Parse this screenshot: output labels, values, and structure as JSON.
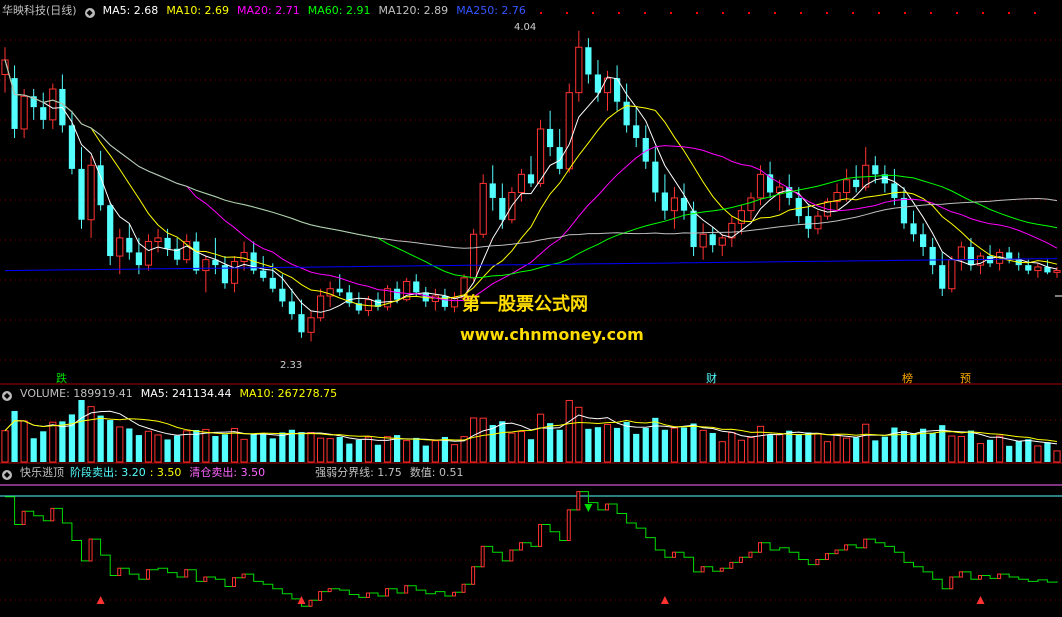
{
  "main": {
    "title": "华映科技(日线)",
    "ma5": "MA5: 2.68",
    "ma10": "MA10: 2.69",
    "ma20": "MA20: 2.71",
    "ma60": "MA60: 2.91",
    "ma120": "MA120: 2.89",
    "ma250": "MA250: 2.76",
    "high_label": "4.04",
    "low_label": "2.33",
    "markers": [
      "跌",
      "财",
      "榜",
      "预"
    ]
  },
  "volume": {
    "title": "VOLUME: 189919.41",
    "ma5": "MA5: 241134.44",
    "ma10": "MA10: 267278.75"
  },
  "indicator": {
    "title": "快乐逃顶",
    "stage_sell": "阶段卖出: 3.20",
    "stage_sell2": ": 3.50",
    "clear_sell": "清仓卖出: 3.50",
    "strength_line": "强弱分界线: 1.75",
    "value": "数值: 0.51"
  },
  "watermark": {
    "name": "第一股票公式网",
    "url": "www.chnmoney.com"
  },
  "colors": {
    "up": "#ff3232",
    "down": "#54ffff",
    "ma5": "#ffffff",
    "ma10": "#ffff00",
    "ma20": "#ff00ff",
    "ma60": "#00ff00",
    "ma120": "#c0c0c0",
    "ma250": "#0000ff",
    "separator": "#aa0000"
  },
  "chart_data": {
    "type": "candlestick",
    "price_range": [
      2.2,
      4.1
    ],
    "candles_ohlc": [
      [
        3.8,
        3.95,
        3.7,
        3.88
      ],
      [
        3.78,
        3.85,
        3.45,
        3.5
      ],
      [
        3.5,
        3.72,
        3.45,
        3.68
      ],
      [
        3.68,
        3.72,
        3.55,
        3.62
      ],
      [
        3.62,
        3.7,
        3.5,
        3.55
      ],
      [
        3.55,
        3.75,
        3.5,
        3.72
      ],
      [
        3.72,
        3.8,
        3.48,
        3.52
      ],
      [
        3.52,
        3.6,
        3.25,
        3.28
      ],
      [
        3.28,
        3.4,
        2.95,
        3.0
      ],
      [
        3.0,
        3.35,
        2.9,
        3.3
      ],
      [
        3.3,
        3.38,
        3.05,
        3.08
      ],
      [
        3.08,
        3.1,
        2.75,
        2.8
      ],
      [
        2.8,
        2.95,
        2.7,
        2.9
      ],
      [
        2.9,
        2.98,
        2.78,
        2.82
      ],
      [
        2.82,
        2.9,
        2.7,
        2.75
      ],
      [
        2.75,
        2.92,
        2.72,
        2.88
      ],
      [
        2.88,
        2.95,
        2.82,
        2.9
      ],
      [
        2.9,
        2.95,
        2.8,
        2.84
      ],
      [
        2.84,
        2.9,
        2.75,
        2.78
      ],
      [
        2.78,
        2.92,
        2.76,
        2.88
      ],
      [
        2.88,
        2.93,
        2.7,
        2.72
      ],
      [
        2.72,
        2.8,
        2.6,
        2.78
      ],
      [
        2.78,
        2.9,
        2.7,
        2.75
      ],
      [
        2.75,
        2.8,
        2.62,
        2.65
      ],
      [
        2.65,
        2.8,
        2.6,
        2.77
      ],
      [
        2.77,
        2.88,
        2.72,
        2.82
      ],
      [
        2.82,
        2.88,
        2.7,
        2.72
      ],
      [
        2.72,
        2.8,
        2.66,
        2.68
      ],
      [
        2.68,
        2.76,
        2.6,
        2.62
      ],
      [
        2.62,
        2.7,
        2.52,
        2.55
      ],
      [
        2.55,
        2.62,
        2.45,
        2.48
      ],
      [
        2.48,
        2.56,
        2.35,
        2.38
      ],
      [
        2.38,
        2.5,
        2.33,
        2.46
      ],
      [
        2.46,
        2.62,
        2.44,
        2.58
      ],
      [
        2.58,
        2.66,
        2.52,
        2.62
      ],
      [
        2.62,
        2.7,
        2.58,
        2.6
      ],
      [
        2.6,
        2.64,
        2.52,
        2.54
      ],
      [
        2.54,
        2.6,
        2.48,
        2.5
      ],
      [
        2.5,
        2.58,
        2.47,
        2.56
      ],
      [
        2.56,
        2.6,
        2.5,
        2.52
      ],
      [
        2.52,
        2.64,
        2.5,
        2.62
      ],
      [
        2.62,
        2.66,
        2.54,
        2.56
      ],
      [
        2.56,
        2.68,
        2.55,
        2.66
      ],
      [
        2.66,
        2.7,
        2.58,
        2.6
      ],
      [
        2.6,
        2.63,
        2.52,
        2.55
      ],
      [
        2.55,
        2.62,
        2.5,
        2.58
      ],
      [
        2.58,
        2.62,
        2.5,
        2.52
      ],
      [
        2.52,
        2.6,
        2.49,
        2.57
      ],
      [
        2.57,
        2.7,
        2.55,
        2.68
      ],
      [
        2.68,
        2.95,
        2.66,
        2.92
      ],
      [
        2.92,
        3.25,
        2.9,
        3.2
      ],
      [
        3.2,
        3.3,
        3.05,
        3.12
      ],
      [
        3.12,
        3.2,
        2.95,
        3.0
      ],
      [
        3.0,
        3.18,
        2.98,
        3.15
      ],
      [
        3.15,
        3.28,
        3.1,
        3.25
      ],
      [
        3.25,
        3.35,
        3.18,
        3.2
      ],
      [
        3.2,
        3.55,
        3.18,
        3.5
      ],
      [
        3.5,
        3.6,
        3.35,
        3.4
      ],
      [
        3.4,
        3.5,
        3.25,
        3.28
      ],
      [
        3.28,
        3.75,
        3.26,
        3.7
      ],
      [
        3.7,
        4.04,
        3.65,
        3.95
      ],
      [
        3.95,
        4.0,
        3.75,
        3.8
      ],
      [
        3.8,
        3.88,
        3.65,
        3.7
      ],
      [
        3.7,
        3.82,
        3.6,
        3.78
      ],
      [
        3.78,
        3.85,
        3.6,
        3.65
      ],
      [
        3.65,
        3.75,
        3.48,
        3.52
      ],
      [
        3.52,
        3.62,
        3.4,
        3.45
      ],
      [
        3.45,
        3.52,
        3.28,
        3.32
      ],
      [
        3.32,
        3.4,
        3.1,
        3.15
      ],
      [
        3.15,
        3.25,
        3.0,
        3.05
      ],
      [
        3.05,
        3.18,
        2.95,
        3.12
      ],
      [
        3.12,
        3.2,
        3.0,
        3.05
      ],
      [
        3.05,
        3.1,
        2.8,
        2.85
      ],
      [
        2.85,
        2.98,
        2.78,
        2.92
      ],
      [
        2.92,
        2.96,
        2.82,
        2.86
      ],
      [
        2.86,
        2.92,
        2.8,
        2.9
      ],
      [
        2.9,
        3.02,
        2.85,
        2.98
      ],
      [
        2.98,
        3.08,
        2.92,
        3.05
      ],
      [
        3.05,
        3.15,
        3.0,
        3.12
      ],
      [
        3.12,
        3.3,
        3.08,
        3.25
      ],
      [
        3.25,
        3.32,
        3.12,
        3.15
      ],
      [
        3.15,
        3.22,
        3.05,
        3.18
      ],
      [
        3.18,
        3.25,
        3.08,
        3.12
      ],
      [
        3.12,
        3.18,
        2.98,
        3.02
      ],
      [
        3.02,
        3.08,
        2.9,
        2.95
      ],
      [
        2.95,
        3.05,
        2.92,
        3.02
      ],
      [
        3.02,
        3.12,
        3.0,
        3.1
      ],
      [
        3.1,
        3.2,
        3.05,
        3.15
      ],
      [
        3.15,
        3.28,
        3.1,
        3.22
      ],
      [
        3.22,
        3.3,
        3.15,
        3.18
      ],
      [
        3.18,
        3.4,
        3.16,
        3.3
      ],
      [
        3.3,
        3.35,
        3.2,
        3.25
      ],
      [
        3.25,
        3.3,
        3.15,
        3.2
      ],
      [
        3.2,
        3.28,
        3.08,
        3.12
      ],
      [
        3.12,
        3.18,
        2.95,
        2.98
      ],
      [
        2.98,
        3.05,
        2.88,
        2.92
      ],
      [
        2.92,
        2.98,
        2.8,
        2.85
      ],
      [
        2.85,
        2.9,
        2.7,
        2.75
      ],
      [
        2.75,
        2.82,
        2.58,
        2.62
      ],
      [
        2.62,
        2.8,
        2.6,
        2.78
      ],
      [
        2.78,
        2.88,
        2.72,
        2.85
      ],
      [
        2.85,
        2.9,
        2.72,
        2.75
      ],
      [
        2.75,
        2.82,
        2.7,
        2.8
      ],
      [
        2.8,
        2.86,
        2.74,
        2.76
      ],
      [
        2.76,
        2.84,
        2.72,
        2.82
      ],
      [
        2.82,
        2.85,
        2.76,
        2.78
      ],
      [
        2.78,
        2.82,
        2.72,
        2.75
      ],
      [
        2.75,
        2.78,
        2.7,
        2.72
      ],
      [
        2.72,
        2.76,
        2.68,
        2.74
      ],
      [
        2.74,
        2.78,
        2.7,
        2.71
      ],
      [
        2.71,
        2.74,
        2.68,
        2.72
      ]
    ]
  }
}
